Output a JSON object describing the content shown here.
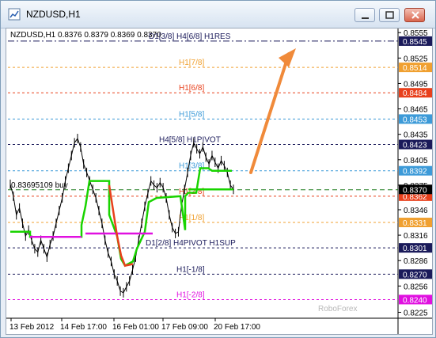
{
  "window": {
    "title": "NZDUSD,H1"
  },
  "header_text": "NZDUSD,H1  0.8376 0.8379 0.8369 0.8370",
  "watermark": "RoboForex",
  "order_label": "0.83695109 buy",
  "colors": {
    "chart_bg": "#ffffff",
    "grid_dark": "#1a1a5a",
    "blue": "#3c9ad8",
    "orange": "#f0a030",
    "red": "#e8401c",
    "green": "#19d400",
    "magenta": "#e010e0",
    "arrow": "#f08a3a",
    "price_line": "#000000"
  },
  "chart_data": {
    "type": "line",
    "ylim": [
      0.8218,
      0.8558
    ],
    "y_ticks": [
      "0.8555",
      "0.8525",
      "0.8495",
      "0.8465",
      "0.8435",
      "0.8405",
      "0.8375",
      "0.8346",
      "0.8316",
      "0.8286",
      "0.8256",
      "0.8225"
    ],
    "x_ticks": [
      "13 Feb 2012",
      "14 Feb 17:00",
      "16 Feb 01:00",
      "17 Feb 09:00",
      "20 Feb 17:00"
    ],
    "levels": [
      {
        "price": 0.8545,
        "label": "D1[3/8] H4[6/8] H1RES",
        "tag": "0.8545",
        "color": "#1a1a5a"
      },
      {
        "price": 0.8514,
        "label": "H1[7/8]",
        "tag": "0.8514",
        "color": "#f0a030"
      },
      {
        "price": 0.8484,
        "label": "H1[6/8]",
        "tag": "0.8484",
        "color": "#e8401c"
      },
      {
        "price": 0.8453,
        "label": "H1[5/8]",
        "tag": "0.8453",
        "color": "#3c9ad8"
      },
      {
        "price": 0.8423,
        "label": "H4[5/8] H1PIVOT",
        "tag": "0.8423",
        "color": "#1a1a5a"
      },
      {
        "price": 0.8392,
        "label": "H1[3/8]",
        "tag": "0.8392",
        "color": "#3c9ad8"
      },
      {
        "price": 0.8362,
        "label": "H1[2/8]",
        "tag": "0.8362",
        "color": "#e8401c"
      },
      {
        "price": 0.8331,
        "label": "H1[1/8]",
        "tag": "0.8331",
        "color": "#f0a030"
      },
      {
        "price": 0.8301,
        "label": "D1[2/8] H4PIVOT H1SUP",
        "tag": "0.8301",
        "color": "#1a1a5a"
      },
      {
        "price": 0.827,
        "label": "H1[-1/8]",
        "tag": "0.8270",
        "color": "#1a1a5a"
      },
      {
        "price": 0.824,
        "label": "H1[-2/8]",
        "tag": "0.8240",
        "color": "#e010e0"
      }
    ],
    "current_price": {
      "price": 0.837,
      "tag": "0.8370"
    },
    "buy_order": {
      "price": 0.83695,
      "label": "0.83695109 buy"
    },
    "series": [
      {
        "values": [
          0.8376,
          0.8362,
          0.834,
          0.8348,
          0.833,
          0.8315,
          0.8322,
          0.831,
          0.83,
          0.8296,
          0.831,
          0.83,
          0.829,
          0.8305,
          0.8315,
          0.833,
          0.8345,
          0.836,
          0.838,
          0.8395,
          0.841,
          0.8425,
          0.843,
          0.842,
          0.84,
          0.839,
          0.838,
          0.837,
          0.836,
          0.8345,
          0.833,
          0.831,
          0.8295,
          0.8285,
          0.827,
          0.8262,
          0.825,
          0.8248,
          0.8255,
          0.8262,
          0.8275,
          0.829,
          0.831,
          0.833,
          0.835,
          0.8365,
          0.838,
          0.8375,
          0.8372,
          0.8378,
          0.8372,
          0.836,
          0.834,
          0.8325,
          0.8318,
          0.832,
          0.835,
          0.837,
          0.839,
          0.841,
          0.8425,
          0.8418,
          0.8412,
          0.842,
          0.8408,
          0.84,
          0.841,
          0.8402,
          0.8395,
          0.8404,
          0.8398,
          0.839,
          0.8375,
          0.837
        ]
      }
    ]
  }
}
